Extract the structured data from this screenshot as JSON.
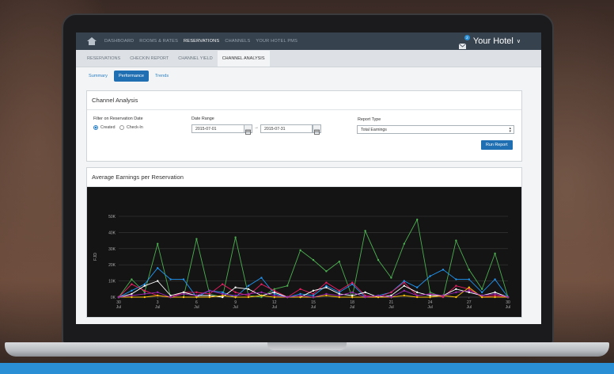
{
  "topnav": {
    "items": [
      "DASHBOARD",
      "ROOMS & RATES",
      "RESERVATIONS",
      "CHANNELS",
      "YOUR HOTEL PMS"
    ],
    "active_index": 2,
    "mail_count": "2",
    "hotel_name": "Your Hotel"
  },
  "subnav": {
    "items": [
      "RESERVATIONS",
      "CHECKIN REPORT",
      "CHANNEL YIELD",
      "CHANNEL ANALYSIS"
    ],
    "active_index": 3
  },
  "tabs": {
    "items": [
      "Summary",
      "Performance",
      "Trends"
    ],
    "active_index": 1
  },
  "filter_panel": {
    "title": "Channel Analysis",
    "reservation_filter_label": "Filter on Reservation Date",
    "radio_created": "Created",
    "radio_checkin": "Check-In",
    "date_range_label": "Date Range",
    "date_from": "2015-07-01",
    "date_to": "2015-07-31",
    "arrow": "→",
    "report_type_label": "Report Type",
    "report_type_value": "Total Earnings",
    "run_button": "Run Report"
  },
  "chart_panel": {
    "title": "Average Earnings per Reservation"
  },
  "colors": {
    "topnav_bg": "#36424e",
    "accent": "#1f6fb2",
    "chart_bg": "#141414"
  },
  "chart_data": {
    "type": "line",
    "title": "",
    "ylabel": "FJD",
    "ylim": [
      0,
      50000
    ],
    "y_ticks": [
      "0K",
      "10K",
      "20K",
      "30K",
      "40K",
      "50K"
    ],
    "x": [
      30,
      1,
      2,
      3,
      4,
      5,
      6,
      7,
      8,
      9,
      10,
      11,
      12,
      13,
      14,
      15,
      16,
      17,
      18,
      19,
      20,
      21,
      22,
      23,
      24,
      25,
      26,
      27,
      28,
      29,
      30
    ],
    "x_tick_labels": [
      {
        "day": "30",
        "month": "Jul"
      },
      {
        "day": "3",
        "month": "Jul"
      },
      {
        "day": "6",
        "month": "Jul"
      },
      {
        "day": "9",
        "month": "Jul"
      },
      {
        "day": "12",
        "month": "Jul"
      },
      {
        "day": "15",
        "month": "Jul"
      },
      {
        "day": "18",
        "month": "Jul"
      },
      {
        "day": "21",
        "month": "Jul"
      },
      {
        "day": "24",
        "month": "Jul"
      },
      {
        "day": "27",
        "month": "Jul"
      },
      {
        "day": "30",
        "month": "Jul"
      }
    ],
    "x_tick_positions": [
      0,
      3,
      6,
      9,
      12,
      15,
      18,
      21,
      24,
      27,
      30
    ],
    "grid": true,
    "series": [
      {
        "color": "#4caf50",
        "values": [
          0,
          11000,
          3000,
          33000,
          0,
          0,
          36000,
          2000,
          0,
          37000,
          1000,
          0,
          5000,
          7000,
          29000,
          23000,
          16000,
          22000,
          0,
          41000,
          23000,
          12000,
          33000,
          48000,
          3000,
          0,
          35000,
          17000,
          5000,
          27000,
          0
        ]
      },
      {
        "color": "#2196f3",
        "values": [
          0,
          4000,
          8000,
          18000,
          11000,
          11000,
          0,
          4000,
          3000,
          0,
          7000,
          12000,
          2000,
          0,
          2000,
          1000,
          7000,
          3000,
          8000,
          0,
          1000,
          3000,
          10000,
          6000,
          13000,
          17000,
          11000,
          11000,
          3000,
          11000,
          0
        ]
      },
      {
        "color": "#e91e63",
        "values": [
          0,
          8000,
          4000,
          1000,
          0,
          3000,
          3000,
          2000,
          8000,
          3000,
          1000,
          8000,
          4000,
          0,
          5000,
          2000,
          9000,
          4000,
          9000,
          1000,
          0,
          3000,
          9000,
          1000,
          2000,
          0,
          7000,
          5000,
          0,
          1000,
          0
        ]
      },
      {
        "color": "#ffffff",
        "values": [
          0,
          2000,
          7000,
          10000,
          1000,
          3000,
          1000,
          1000,
          0,
          6000,
          5000,
          1000,
          3000,
          0,
          0,
          4000,
          6000,
          2000,
          1000,
          3000,
          0,
          1000,
          7000,
          3000,
          1000,
          1000,
          5000,
          3000,
          1000,
          3000,
          0
        ]
      },
      {
        "color": "#ffc107",
        "values": [
          0,
          0,
          0,
          1000,
          0,
          0,
          0,
          0,
          1000,
          0,
          0,
          1000,
          0,
          0,
          0,
          0,
          1000,
          0,
          0,
          0,
          0,
          0,
          1000,
          0,
          0,
          1000,
          0,
          6000,
          0,
          0,
          0
        ]
      },
      {
        "color": "#9c27b0",
        "values": [
          0,
          1000,
          2000,
          3000,
          0,
          2000,
          1000,
          4000,
          2000,
          1000,
          2000,
          3000,
          1000,
          0,
          1000,
          0,
          2000,
          1000,
          3000,
          0,
          1000,
          0,
          4000,
          1000,
          2000,
          1000,
          3000,
          4000,
          1000,
          2000,
          0
        ]
      }
    ]
  }
}
